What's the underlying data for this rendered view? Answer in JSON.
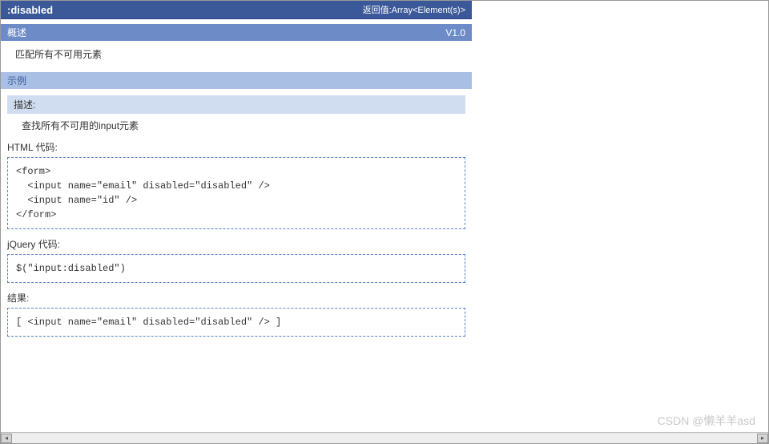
{
  "title": {
    "name": ":disabled",
    "return_type": "返回值:Array<Element(s)>"
  },
  "overview": {
    "header": "概述",
    "version": "V1.0",
    "text": "匹配所有不可用元素"
  },
  "example": {
    "header": "示例"
  },
  "description": {
    "header": "描述:",
    "text": "查找所有不可用的input元素"
  },
  "html_code": {
    "label": "HTML 代码:",
    "code": "<form>\n  <input name=\"email\" disabled=\"disabled\" />\n  <input name=\"id\" />\n</form>"
  },
  "jquery_code": {
    "label": "jQuery 代码:",
    "code": "$(\"input:disabled\")"
  },
  "result": {
    "label": "结果:",
    "code": "[ <input name=\"email\" disabled=\"disabled\" /> ]"
  },
  "watermark": "CSDN @懒羊羊asd"
}
